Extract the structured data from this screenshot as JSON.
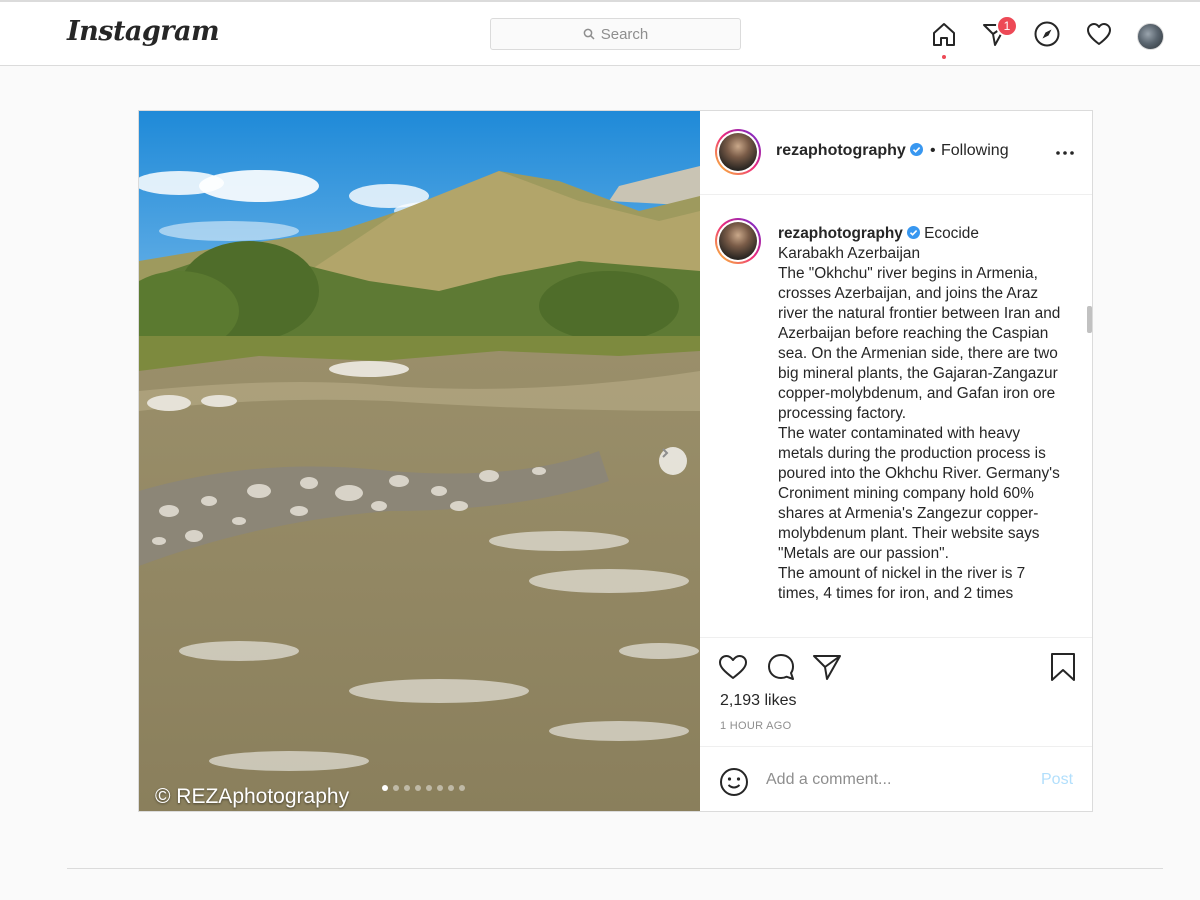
{
  "header": {
    "logo": "Instagram",
    "search_placeholder": "Search",
    "notification_count": "1",
    "icons": [
      "home-icon",
      "direct-icon",
      "explore-icon",
      "activity-heart-icon",
      "profile-avatar"
    ]
  },
  "post": {
    "photo_watermark": "© REZAphotography",
    "carousel": {
      "total": 8,
      "active_index": 0
    },
    "author": {
      "username": "rezaphotography",
      "verified": true,
      "separator": "•",
      "follow_status": "Following"
    },
    "caption": {
      "username": "rezaphotography",
      "text": "Ecocide\nKarabakh Azerbaijan\nThe \"Okhchu\" river begins in Armenia, crosses Azerbaijan, and joins the Araz river the natural frontier between Iran and Azerbaijan before reaching the Caspian sea. On the Armenian side, there are two big mineral plants, the Gajaran-Zangazur copper-molybdenum, and Gafan iron ore processing factory.\nThe water contaminated with heavy metals during the production process is poured into the Okhchu River. Germany's Croniment mining company hold 60% shares at Armenia's Zangezur copper-molybdenum plant. Their website says \"Metals are our passion\".\nThe amount of nickel in the river is 7 times, 4 times for iron, and 2 times"
    },
    "likes": "2,193 likes",
    "timestamp": "1 HOUR AGO",
    "comment_placeholder": "Add a comment...",
    "post_button": "Post"
  },
  "colors": {
    "notification": "#ed4956",
    "verified": "#3897f0",
    "post_button_disabled": "#b2dffc"
  }
}
